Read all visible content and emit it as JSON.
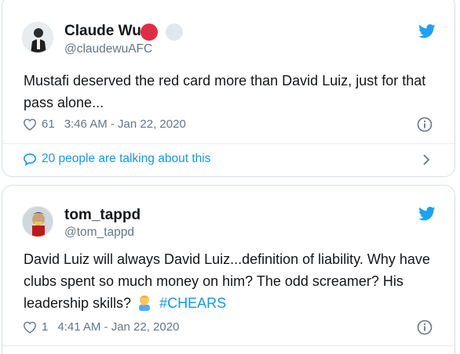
{
  "tweets": [
    {
      "name": "Claude Wu",
      "handle": "@claudewuAFC",
      "text": "Mustafi deserved the red card more than David Luiz, just for that pass alone...",
      "likes": "61",
      "timestamp": "3:46 AM - Jan 22, 2020",
      "talking": "20 people are talking about this",
      "badges": [
        "red-circle",
        "grey-circle"
      ],
      "badge_colors": [
        "#dd2e44",
        "#e1e8ed"
      ]
    },
    {
      "name": "tom_tappd",
      "handle": "@tom_tappd",
      "text_line1": "David Luiz will always David Luiz...definition of liability. Why have",
      "text_line2": "clubs spent so much money on him? The odd screamer? His",
      "text_line3": "leadership skills?",
      "emoji": "man-facepalming",
      "hashtag": "#CHEARS",
      "likes": "1",
      "timestamp": "4:41 AM - Jan 22, 2020"
    }
  ],
  "icons": {
    "brand": "twitter-bird-icon",
    "like": "heart-icon",
    "info": "info-icon",
    "reply": "speech-bubble-icon",
    "expand": "chevron-right-icon"
  },
  "colors": {
    "accent": "#1b95e0",
    "muted": "#657786",
    "border": "#d6dfe5"
  }
}
